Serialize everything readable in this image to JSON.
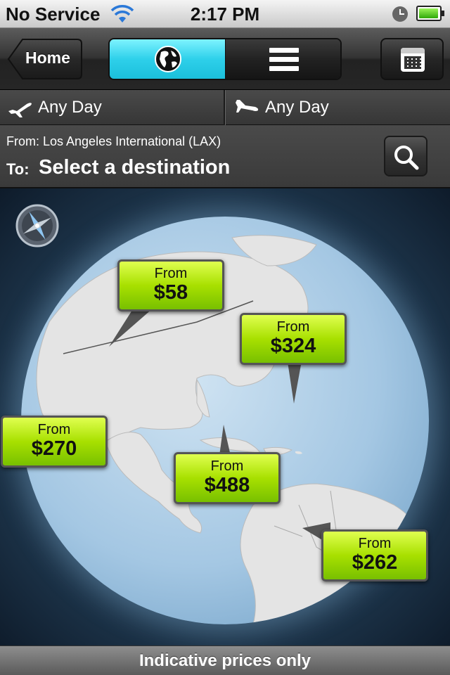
{
  "status_bar": {
    "carrier": "No Service",
    "time": "2:17 PM",
    "battery_level": 0.95
  },
  "nav": {
    "home_label": "Home",
    "view_toggle": [
      "globe-view",
      "list-view"
    ],
    "selected_view": "globe-view",
    "accent_color": "#2ed0ea"
  },
  "dates": {
    "depart_label": "Any Day",
    "return_label": "Any Day"
  },
  "route": {
    "from_text": "From: Los Angeles International (LAX)",
    "to_label": "To:",
    "to_value": "Select a destination"
  },
  "price_tags": [
    {
      "from_label": "From",
      "price": "$58"
    },
    {
      "from_label": "From",
      "price": "$324"
    },
    {
      "from_label": "From",
      "price": "$270"
    },
    {
      "from_label": "From",
      "price": "$488"
    },
    {
      "from_label": "From",
      "price": "$262"
    }
  ],
  "footer": {
    "note": "Indicative prices only"
  },
  "icons": [
    "wifi-icon",
    "clock-icon",
    "battery-icon",
    "globe-icon",
    "list-icon",
    "calendar-icon",
    "plane-depart-icon",
    "plane-arrive-icon",
    "search-icon",
    "compass-icon"
  ]
}
